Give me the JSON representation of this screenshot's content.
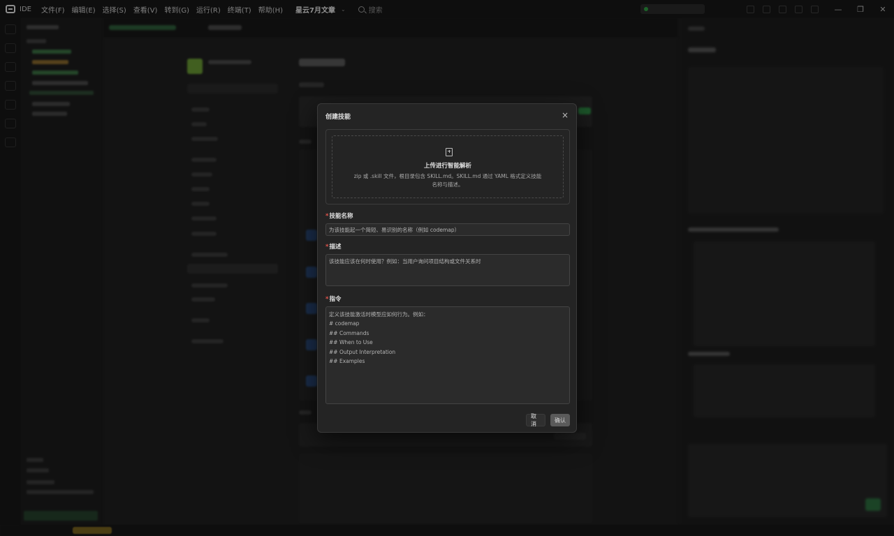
{
  "titlebar": {
    "app_name": "IDE",
    "menu": [
      "文件(F)",
      "编辑(E)",
      "选择(S)",
      "查看(V)",
      "转到(G)",
      "运行(R)",
      "终端(T)",
      "帮助(H)"
    ],
    "project": "星云7月文章",
    "search_placeholder": "搜索",
    "window_controls": [
      "—",
      "❐",
      "✕"
    ]
  },
  "dialog": {
    "title": "创建技能",
    "close": "×",
    "upload": {
      "title": "上传进行智能解析",
      "description": "zip 或 .skill 文件，根目录包含 SKILL.md。SKILL.md 通过 YAML 格式定义技能名称与描述。"
    },
    "name_field": {
      "required_mark": "*",
      "label": "技能名称",
      "placeholder": "为该技能起一个简短、易识别的名称（例如 codemap）"
    },
    "description_field": {
      "required_mark": "*",
      "label": "描述",
      "placeholder": "该技能应该在何时使用？例如：当用户询问项目结构或文件关系时"
    },
    "instruction_field": {
      "required_mark": "*",
      "label": "指令",
      "placeholder_lines": [
        "定义该技能激活时模型应如何行为。例如：",
        "# codemap",
        "## Commands",
        "## When to Use",
        "## Output Interpretation",
        "## Examples"
      ]
    },
    "cancel_label": "取消",
    "confirm_label": "确认"
  },
  "colors": {
    "background": "#1e1e1e",
    "dialog_bg": "#242424",
    "required": "#e2554c",
    "accent_green": "#2ea043"
  },
  "icons": {
    "logo": "app-logo-icon",
    "search": "search-icon",
    "upload": "file-upload-icon",
    "close": "close-icon",
    "chevron": "chevron-down-icon"
  }
}
